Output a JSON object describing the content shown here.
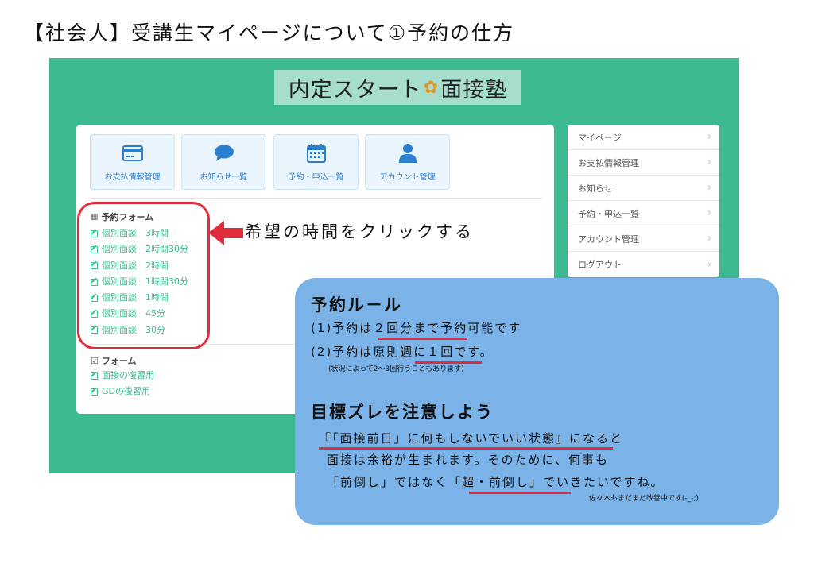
{
  "page": {
    "title": "【社会人】受講生マイページについて①予約の仕方"
  },
  "app": {
    "logo_left": "内定スタート",
    "logo_right": "面接塾"
  },
  "tiles": [
    {
      "label": "お支払情報管理",
      "icon": "credit-card-icon"
    },
    {
      "label": "お知らせ一覧",
      "icon": "speech-bubble-icon"
    },
    {
      "label": "予約・申込一覧",
      "icon": "calendar-icon"
    },
    {
      "label": "アカウント管理",
      "icon": "user-icon"
    }
  ],
  "reservation_form": {
    "heading": "予約フォーム",
    "items": [
      "個別面談　3時間",
      "個別面談　2時間30分",
      "個別面談　2時間",
      "個別面談　1時間30分",
      "個別面談　1時間",
      "個別面談　45分",
      "個別面談　30分"
    ]
  },
  "form_section": {
    "heading": "フォーム",
    "items": [
      "面接の復習用",
      "GDの復習用"
    ]
  },
  "sidebar": {
    "items": [
      "マイページ",
      "お支払情報管理",
      "お知らせ",
      "予約・申込一覧",
      "アカウント管理",
      "ログアウト"
    ]
  },
  "annotation": {
    "arrow_text": "希望の時間をクリックする"
  },
  "rules": {
    "heading": "予約ル－ル",
    "line1": "(1)予約は２回分まで予約可能です",
    "line2": "(2)予約は原則週に１回です。",
    "note": "(状況によって2～3回行うこともあります)"
  },
  "goal": {
    "heading": "目標ズレを注意しよう",
    "line1": "『「面接前日」に何もしないでいい状態』になると",
    "line2": "面接は余裕が生まれます。そのために、何事も",
    "line3": "「前倒し」ではなく「超・前倒し」でいきたいですね。",
    "signature": "佐々木もまだまだ改善中です(-_-;)"
  },
  "colors": {
    "frame": "#3db992",
    "logo_bg": "#a6ddcc",
    "tile_text": "#2b7fd0",
    "highlight": "#e02d3b",
    "rule_box": "#7bb3e8"
  }
}
